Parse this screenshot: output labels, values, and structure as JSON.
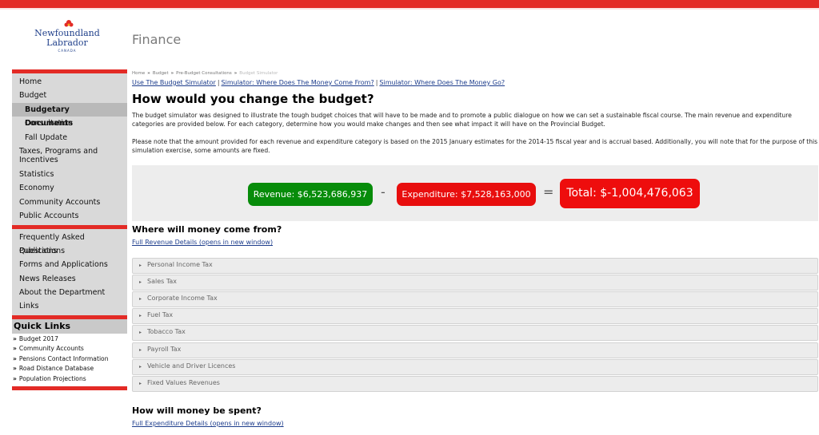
{
  "header": {
    "logo_line1": "Newfoundland",
    "logo_line2": "Labrador",
    "logo_line3": "CANADA",
    "department": "Finance"
  },
  "sidebar": {
    "group1": [
      {
        "label": "Home"
      },
      {
        "label": "Budget"
      },
      {
        "label": "Budgetary Documents"
      },
      {
        "label": "Consultation"
      },
      {
        "label": "Fall Update"
      },
      {
        "label": "Taxes, Programs and Incentives"
      },
      {
        "label": "Statistics"
      },
      {
        "label": "Economy"
      },
      {
        "label": "Community Accounts"
      },
      {
        "label": "Public Accounts"
      }
    ],
    "group2": [
      {
        "label": "Frequently Asked Questions"
      },
      {
        "label": "Publications"
      },
      {
        "label": "Forms and Applications"
      },
      {
        "label": "News Releases"
      },
      {
        "label": "About the Department"
      },
      {
        "label": "Links"
      }
    ],
    "quick_links_title": "Quick Links",
    "quick_links": [
      {
        "label": "Budget 2017"
      },
      {
        "label": "Community Accounts"
      },
      {
        "label": "Pensions Contact Information"
      },
      {
        "label": "Road Distance Database"
      },
      {
        "label": "Population Projections"
      }
    ]
  },
  "breadcrumb": [
    "Home",
    "Budget",
    "Pre-Budget Consultations",
    "Budget Simulator"
  ],
  "tools": [
    "Use The Budget Simulator",
    "Simulator: Where Does The Money Come From?",
    "Simulator: Where Does The Money Go?"
  ],
  "main": {
    "title": "How would you change the budget?",
    "para1": "The budget simulator was designed to illustrate the tough budget choices that will have to be made and to promote a public dialogue on how we can set a sustainable fiscal course. The main revenue and expenditure categories are provided below. For each category, determine how you would make changes and then see what impact it will have on the Provincial Budget.",
    "para2": "Please note that the amount provided for each revenue and expenditure category is based on the 2015 January estimates for the 2014-15 fiscal year and is accrual based. Additionally, you will note that for the purpose of this simulation exercise, some amounts are fixed."
  },
  "totals": {
    "revenue": "Revenue: $6,523,686,937",
    "minus": "-",
    "expenditure": "Expenditure: $7,528,163,000",
    "equals": "=",
    "total": "Total: $-1,004,476,063",
    "revenue_color": "#078c0a",
    "expenditure_color": "#e80e0e"
  },
  "revenue_section": {
    "title": "Where will money come from?",
    "link": "Full Revenue Details (opens in new window)",
    "items": [
      {
        "label": "Personal Income Tax"
      },
      {
        "label": "Sales Tax"
      },
      {
        "label": "Corporate Income Tax"
      },
      {
        "label": "Fuel Tax"
      },
      {
        "label": "Tobacco Tax"
      },
      {
        "label": "Payroll Tax"
      },
      {
        "label": "Vehicle and Driver Licences"
      },
      {
        "label": "Fixed Values Revenues"
      }
    ]
  },
  "expense_section": {
    "title": "How will money be spent?",
    "link": "Full Expenditure Details (opens in new window)"
  },
  "icons": {
    "breadcrumb_sep": "»",
    "quick_link_bullet": "»",
    "accordion": "▸"
  }
}
